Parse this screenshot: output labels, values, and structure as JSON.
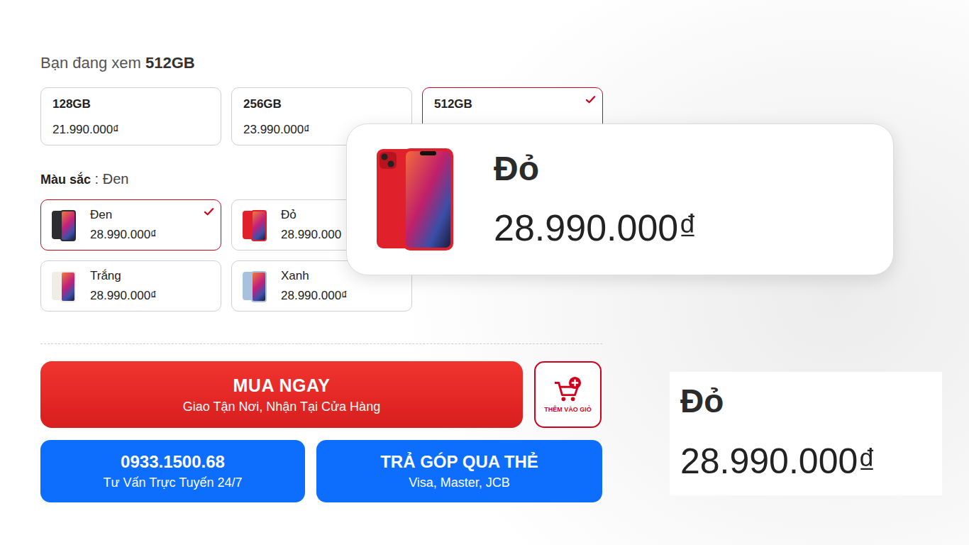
{
  "viewing": {
    "label": "Bạn đang xem",
    "value": "512GB"
  },
  "storage_options": [
    {
      "label": "128GB",
      "price": "21.990.000₫",
      "selected": false
    },
    {
      "label": "256GB",
      "price": "23.990.000₫",
      "selected": false
    },
    {
      "label": "512GB",
      "selected": true
    }
  ],
  "color": {
    "label": "Màu sắc",
    "separator": ":",
    "value": "Đen"
  },
  "color_options": [
    {
      "name": "Đen",
      "price": "28.990.000₫",
      "selected": true,
      "color": "#2b2d31"
    },
    {
      "name": "Đỏ",
      "price": "28.990.000",
      "selected": false,
      "color": "#e0202a"
    },
    {
      "name": "Trắng",
      "price": "28.990.000₫",
      "selected": false,
      "color": "#f1ede6"
    },
    {
      "name": "Xanh",
      "price": "28.990.000₫",
      "selected": false,
      "color": "#a8c1dc"
    }
  ],
  "zoom_card": {
    "name": "Đỏ",
    "price": "28.990.000₫",
    "color": "#e0202a"
  },
  "zoom_crop": {
    "name": "Đỏ",
    "price": "28.990.000₫"
  },
  "buy_button": {
    "title": "MUA NGAY",
    "subtitle": "Giao Tận Nơi, Nhận Tại Cửa Hàng"
  },
  "cart_button": {
    "label": "THÊM VÀO GIỎ"
  },
  "hotline_button": {
    "title": "0933.1500.68",
    "subtitle": "Tư Vấn Trực Tuyến 24/7"
  },
  "installment_button": {
    "title": "TRẢ GÓP QUA THẺ",
    "subtitle": "Visa, Master, JCB"
  }
}
